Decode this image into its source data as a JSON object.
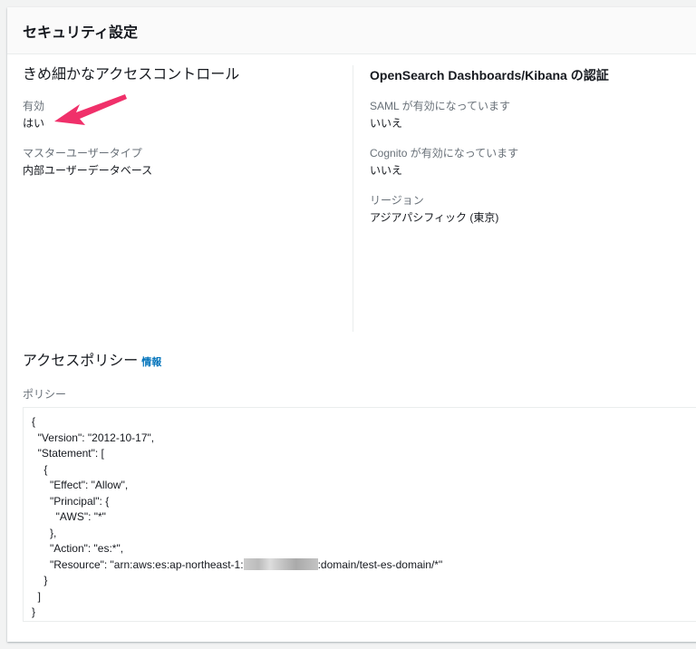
{
  "header": {
    "title": "セキュリティ設定"
  },
  "fgac": {
    "title": "きめ細かなアクセスコントロール",
    "fields": [
      {
        "label": "有効",
        "value": "はい"
      },
      {
        "label": "マスターユーザータイプ",
        "value": "内部ユーザーデータベース"
      }
    ]
  },
  "auth": {
    "title": "OpenSearch Dashboards/Kibana の認証",
    "fields": [
      {
        "label": "SAML が有効になっています",
        "value": "いいえ"
      },
      {
        "label": "Cognito が有効になっています",
        "value": "いいえ"
      },
      {
        "label": "リージョン",
        "value": "アジアパシフィック (東京)"
      }
    ]
  },
  "policy": {
    "title": "アクセスポリシー",
    "info_link": "情報",
    "label": "ポリシー",
    "lines": [
      "{",
      "  \"Version\": \"2012-10-17\",",
      "  \"Statement\": [",
      "    {",
      "      \"Effect\": \"Allow\",",
      "      \"Principal\": {",
      "        \"AWS\": \"*\"",
      "      },",
      "      \"Action\": \"es:*\","
    ],
    "resource_prefix": "      \"Resource\": \"arn:aws:es:ap-northeast-1:",
    "resource_suffix": ":domain/test-es-domain/*\"",
    "closing_lines": [
      "    }",
      "  ]",
      "}"
    ]
  },
  "annotation_color": "#f0306a"
}
